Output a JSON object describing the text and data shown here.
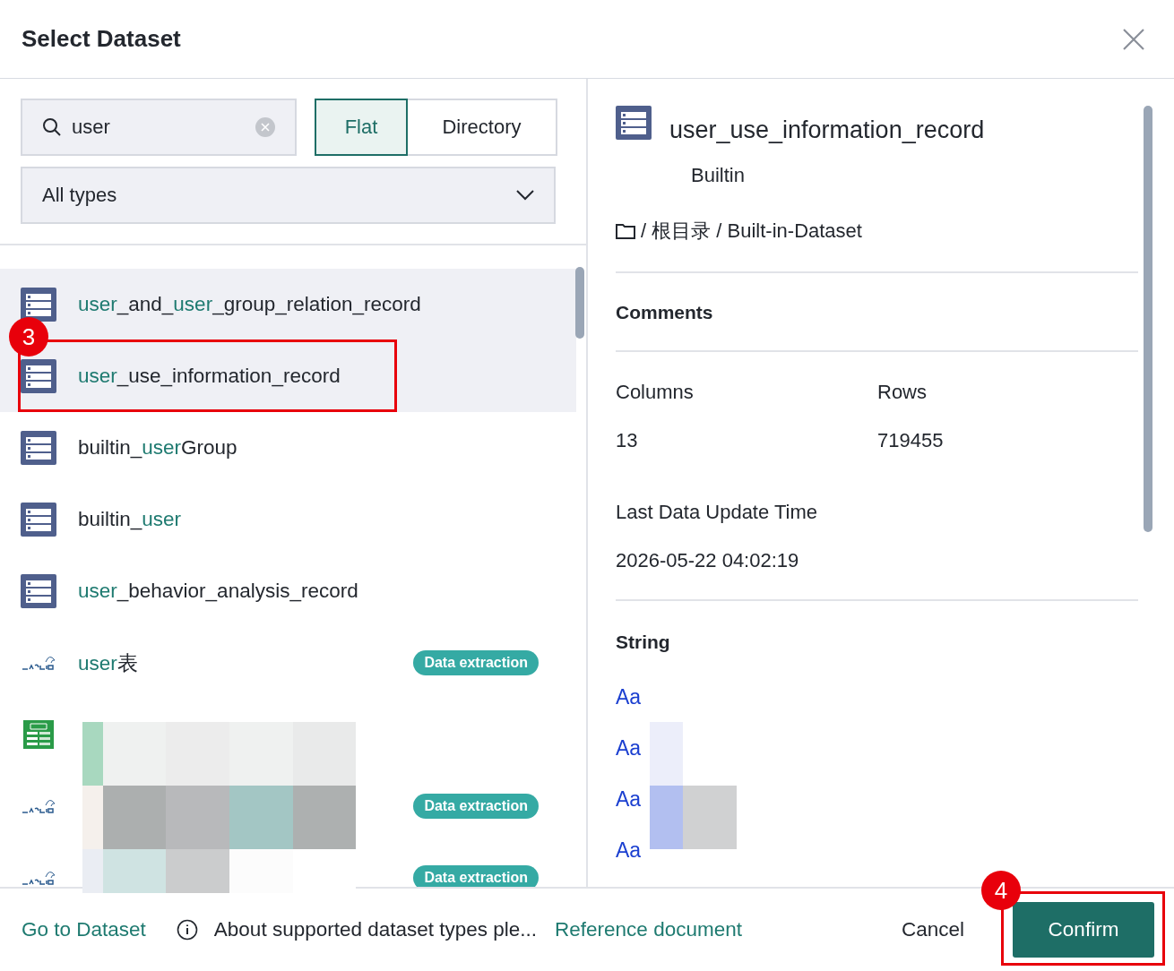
{
  "dialog": {
    "title": "Select Dataset"
  },
  "search": {
    "value": "user"
  },
  "view_toggle": [
    {
      "label": "Flat",
      "selected": true
    },
    {
      "label": "Directory",
      "selected": false
    }
  ],
  "type_filter": {
    "value": "All types"
  },
  "datasets": [
    {
      "kind": "builtin",
      "highlighted": true,
      "name": [
        {
          "text": "user",
          "match": true
        },
        {
          "text": "_and_",
          "match": false
        },
        {
          "text": "user",
          "match": true
        },
        {
          "text": "_group_relation_record",
          "match": false
        }
      ]
    },
    {
      "kind": "builtin",
      "highlighted": true,
      "name": [
        {
          "text": "user",
          "match": true
        },
        {
          "text": "_use_information_record",
          "match": false
        }
      ]
    },
    {
      "kind": "builtin",
      "highlighted": false,
      "name": [
        {
          "text": "builtin_",
          "match": false
        },
        {
          "text": "user",
          "match": true
        },
        {
          "text": "Group",
          "match": false
        }
      ]
    },
    {
      "kind": "builtin",
      "highlighted": false,
      "name": [
        {
          "text": "builtin_",
          "match": false
        },
        {
          "text": "user",
          "match": true
        }
      ]
    },
    {
      "kind": "builtin",
      "highlighted": false,
      "name": [
        {
          "text": "user",
          "match": true
        },
        {
          "text": "_behavior_analysis_record",
          "match": false
        }
      ]
    },
    {
      "kind": "mysql",
      "highlighted": false,
      "name": [
        {
          "text": "user",
          "match": true
        },
        {
          "text": "表",
          "match": false
        }
      ],
      "badge": "Data extraction"
    },
    {
      "kind": "csv",
      "highlighted": false
    },
    {
      "kind": "mysql",
      "highlighted": false,
      "badge": "Data extraction"
    },
    {
      "kind": "mysql",
      "highlighted": false,
      "badge": "Data extraction"
    }
  ],
  "detail": {
    "name": "user_use_information_record",
    "source": "Builtin",
    "path": "/ 根目录 / Built-in-Dataset",
    "comments_label": "Comments",
    "stats": [
      {
        "label": "Columns",
        "value": "13"
      },
      {
        "label": "Rows",
        "value": "719455"
      }
    ],
    "update_label": "Last Data Update Time",
    "update_value": "2026-05-22 04:02:19",
    "field_group": "String",
    "fields": [
      {
        "type_icon": "Aa"
      },
      {
        "type_icon": "Aa"
      },
      {
        "type_icon": "Aa"
      },
      {
        "type_icon": "Aa"
      }
    ]
  },
  "footer": {
    "go_link": "Go to Dataset",
    "info": "About supported dataset types ple...",
    "doc_link": "Reference document",
    "cancel": "Cancel",
    "confirm": "Confirm"
  },
  "annotations": [
    {
      "label": "3"
    },
    {
      "label": "4"
    }
  ]
}
